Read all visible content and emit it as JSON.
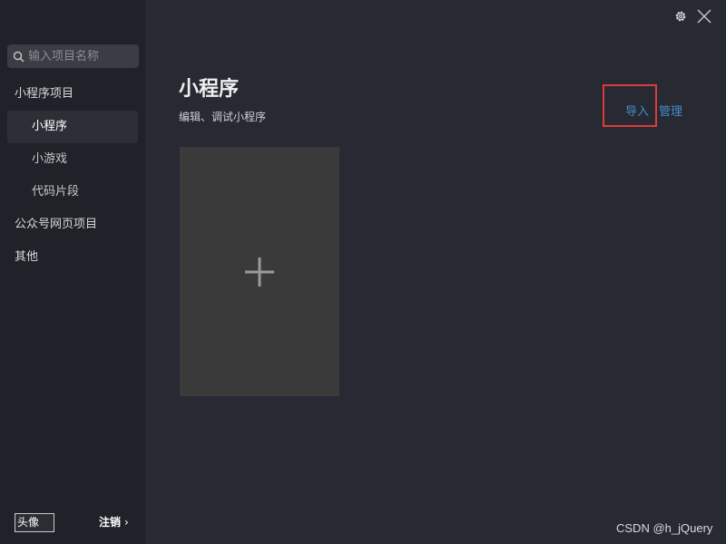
{
  "search": {
    "placeholder": "输入项目名称"
  },
  "sidebar": {
    "items": [
      {
        "label": "小程序项目"
      },
      {
        "label": "小程序"
      },
      {
        "label": "小游戏"
      },
      {
        "label": "代码片段"
      },
      {
        "label": "公众号网页项目"
      },
      {
        "label": "其他"
      }
    ],
    "avatar_alt": "头像",
    "logout_label": "注销",
    "logout_chevron": "›"
  },
  "main": {
    "title": "小程序",
    "subtitle": "编辑、调试小程序",
    "import_label": "导入",
    "manage_label": "管理"
  },
  "watermark": "CSDN @h_jQuery",
  "colors": {
    "background": "#272a33",
    "sidebar": "#1f2228",
    "link": "#4a8bc8",
    "highlight_box": "#e03a3a",
    "card": "#3a3a3a"
  },
  "icons": [
    "search-icon",
    "gear-icon",
    "close-icon",
    "plus-icon"
  ]
}
